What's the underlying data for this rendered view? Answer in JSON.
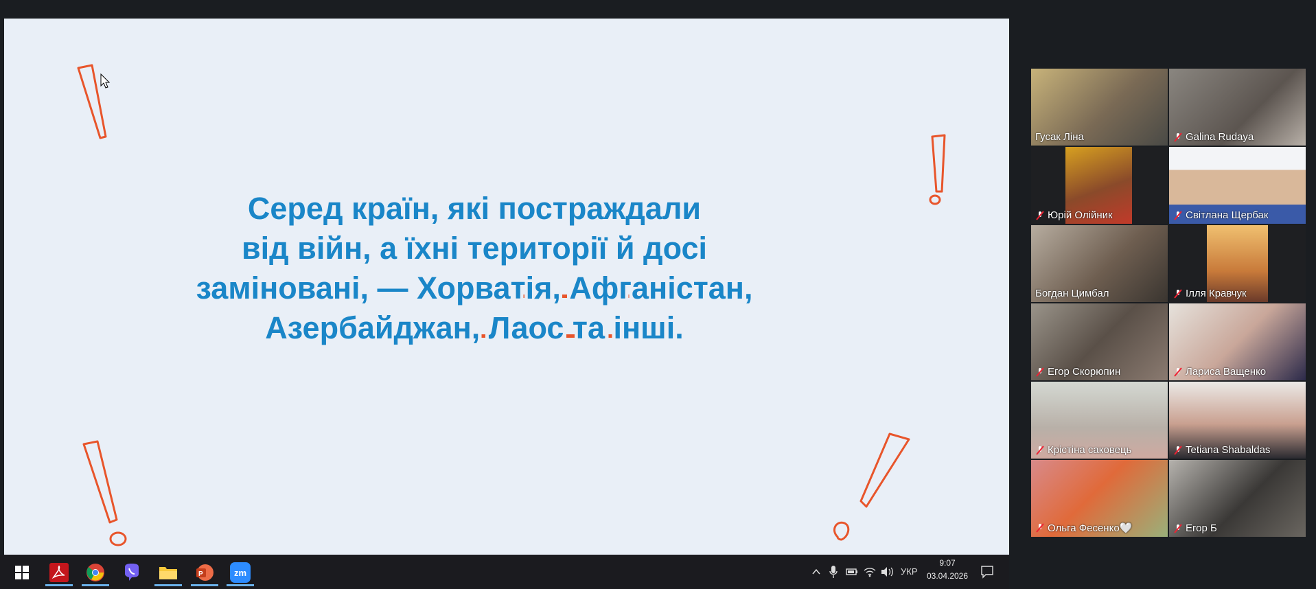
{
  "slide": {
    "text_line1": "Серед країн, які постраждали",
    "text_line2": "від війн, а їхні території й досі",
    "text_line3_plain": "заміновані, — ",
    "text_line3_underlined": "Хорватія, Афганістан,",
    "text_line4_underlined": "Азербайджан, Лаос та інші",
    "text_line4_end": ".",
    "text_color": "#1a86c8",
    "accent_color": "#e8552b"
  },
  "participants": [
    {
      "name": "Гусак Ліна",
      "muted": false,
      "active": true
    },
    {
      "name": "Galina Rudaya",
      "muted": true,
      "active": false
    },
    {
      "name": "Юрій Олійник",
      "muted": true,
      "active": false
    },
    {
      "name": "Світлана Щербак",
      "muted": true,
      "active": false
    },
    {
      "name": "Богдан Цимбал",
      "muted": false,
      "active": false
    },
    {
      "name": "Ілля Кравчук",
      "muted": true,
      "active": false
    },
    {
      "name": "Егор Скорюпин",
      "muted": true,
      "active": false
    },
    {
      "name": "Лариса Ващенко",
      "muted": true,
      "active": false
    },
    {
      "name": "Крістіна  саковець",
      "muted": true,
      "active": false
    },
    {
      "name": "Tetiana Shabaldas",
      "muted": true,
      "active": false
    },
    {
      "name": "Ольга Фесенко🤍",
      "muted": true,
      "active": false
    },
    {
      "name": "Егор Б",
      "muted": true,
      "active": false
    }
  ],
  "taskbar": {
    "apps": [
      "windows-start-icon",
      "acrobat-icon",
      "chrome-icon",
      "viber-icon",
      "file-explorer-icon",
      "powerpoint-icon",
      "zoom-icon"
    ],
    "zoom_label": "zm",
    "language": "УКР",
    "time": "9:07",
    "date": "03.04.2026"
  }
}
